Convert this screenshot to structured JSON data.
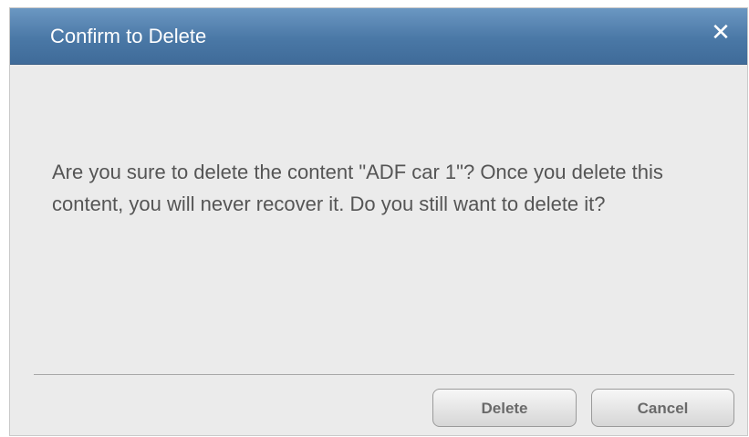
{
  "dialog": {
    "title": "Confirm to Delete",
    "close_glyph": "✕",
    "message": "Are you sure to delete the content \"ADF car 1\"? Once you delete this content, you will never recover it. Do you still want to delete it?",
    "buttons": {
      "delete_label": "Delete",
      "cancel_label": "Cancel"
    }
  },
  "colors": {
    "titlebar": "#4a78a6",
    "body_bg": "#ebebeb",
    "text": "#555555"
  }
}
